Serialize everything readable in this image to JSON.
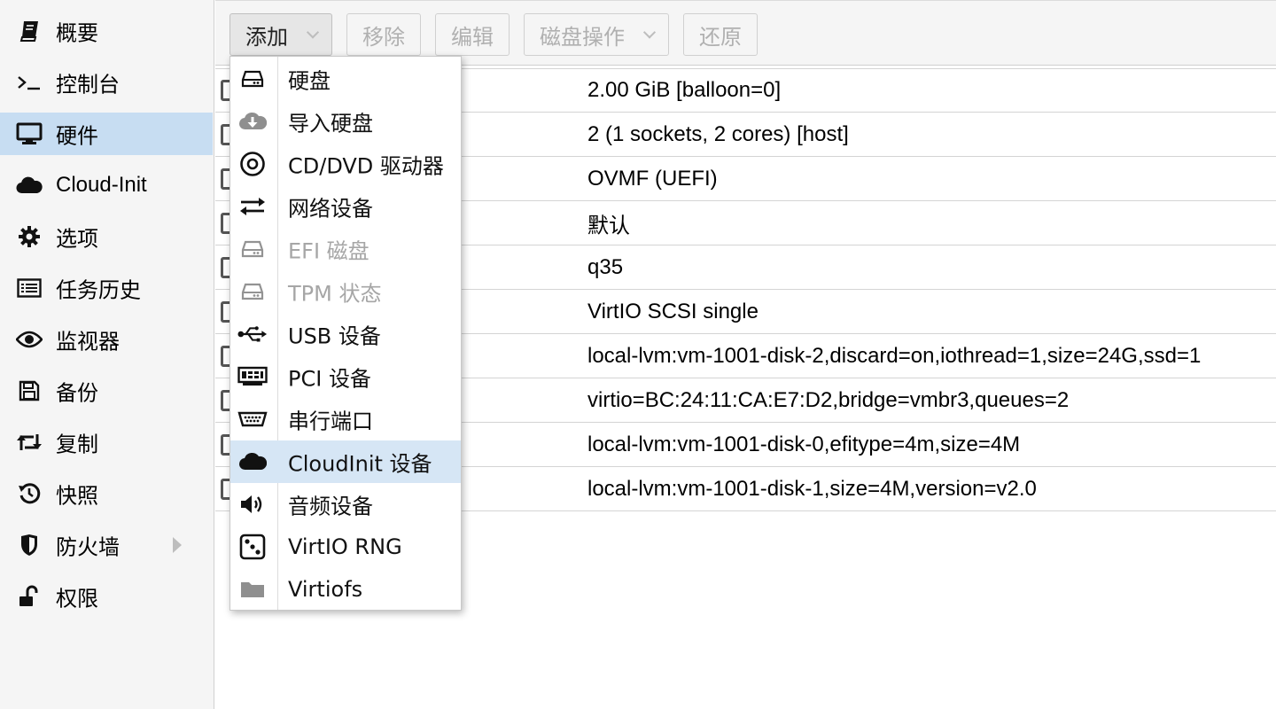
{
  "sidebar": {
    "items": [
      {
        "label": "概要",
        "icon": "book-icon"
      },
      {
        "label": "控制台",
        "icon": "terminal-icon"
      },
      {
        "label": "硬件",
        "icon": "desktop-icon",
        "active": true
      },
      {
        "label": "Cloud-Init",
        "icon": "cloud-icon"
      },
      {
        "label": "选项",
        "icon": "gear-icon"
      },
      {
        "label": "任务历史",
        "icon": "list-icon"
      },
      {
        "label": "监视器",
        "icon": "eye-icon"
      },
      {
        "label": "备份",
        "icon": "floppy-icon"
      },
      {
        "label": "复制",
        "icon": "retweet-icon"
      },
      {
        "label": "快照",
        "icon": "history-icon"
      },
      {
        "label": "防火墙",
        "icon": "shield-icon",
        "has_submenu": true
      },
      {
        "label": "权限",
        "icon": "unlock-icon"
      }
    ]
  },
  "toolbar": {
    "add_label": "添加",
    "remove_label": "移除",
    "edit_label": "编辑",
    "disk_action_label": "磁盘操作",
    "revert_label": "还原"
  },
  "hardware": {
    "rows": [
      {
        "value": "2.00 GiB [balloon=0]"
      },
      {
        "value": "2 (1 sockets, 2 cores) [host]"
      },
      {
        "value": "OVMF (UEFI)"
      },
      {
        "value": "默认"
      },
      {
        "value": "q35"
      },
      {
        "value": "VirtIO SCSI single"
      },
      {
        "value": "local-lvm:vm-1001-disk-2,discard=on,iothread=1,size=24G,ssd=1"
      },
      {
        "value": "virtio=BC:24:11:CA:E7:D2,bridge=vmbr3,queues=2"
      },
      {
        "value": "local-lvm:vm-1001-disk-0,efitype=4m,size=4M"
      },
      {
        "value": "local-lvm:vm-1001-disk-1,size=4M,version=v2.0"
      }
    ]
  },
  "add_menu": {
    "items": [
      {
        "label": "硬盘",
        "icon": "hdd-icon"
      },
      {
        "label": "导入硬盘",
        "icon": "cloud-download-icon"
      },
      {
        "label": "CD/DVD 驱动器",
        "icon": "optical-disc-icon"
      },
      {
        "label": "网络设备",
        "icon": "exchange-icon"
      },
      {
        "label": "EFI 磁盘",
        "icon": "hdd-icon",
        "disabled": true
      },
      {
        "label": "TPM 状态",
        "icon": "hdd-icon",
        "disabled": true
      },
      {
        "label": "USB 设备",
        "icon": "usb-icon"
      },
      {
        "label": "PCI 设备",
        "icon": "pci-card-icon"
      },
      {
        "label": "串行端口",
        "icon": "serial-port-icon"
      },
      {
        "label": "CloudInit 设备",
        "icon": "cloud-icon",
        "active": true
      },
      {
        "label": "音频设备",
        "icon": "volume-icon"
      },
      {
        "label": "VirtIO RNG",
        "icon": "dice-icon"
      },
      {
        "label": "Virtiofs",
        "icon": "folder-icon"
      }
    ]
  },
  "colors": {
    "sidebar_active": "#c7ddf2",
    "menu_active": "#d6e6f5",
    "disabled_text": "#a6a6a6"
  }
}
